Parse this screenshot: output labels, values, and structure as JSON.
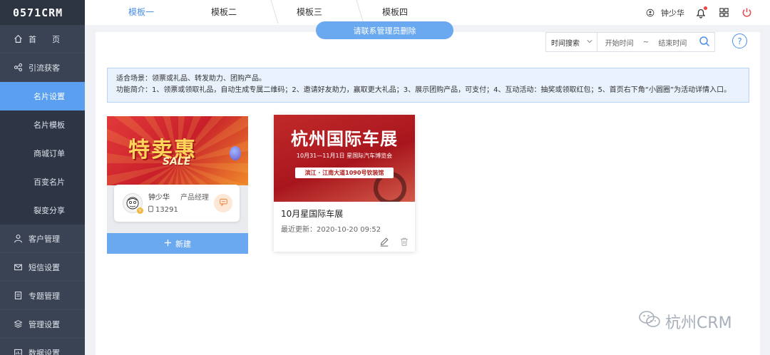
{
  "app": {
    "logo": "0571CRM"
  },
  "sidebar": {
    "items": [
      {
        "label": "首　　页",
        "icon": "home-icon"
      },
      {
        "label": "引流获客",
        "icon": "share-nodes-icon"
      },
      {
        "label": "客户管理",
        "icon": "user-icon"
      },
      {
        "label": "短信设置",
        "icon": "mail-icon"
      },
      {
        "label": "专题管理",
        "icon": "document-icon"
      },
      {
        "label": "管理设置",
        "icon": "layers-icon"
      },
      {
        "label": "数据设置",
        "icon": "chart-icon"
      }
    ],
    "sub_items": [
      {
        "label": "名片设置",
        "active": true
      },
      {
        "label": "名片模板"
      },
      {
        "label": "商城订单"
      },
      {
        "label": "百变名片"
      },
      {
        "label": "裂变分享"
      }
    ]
  },
  "header": {
    "username": "钟少华"
  },
  "tabs": [
    {
      "label": "模板一",
      "active": true
    },
    {
      "label": "模板二"
    },
    {
      "label": "模板三"
    },
    {
      "label": "模板四"
    }
  ],
  "tip_pill": "请联系管理员删除",
  "search": {
    "type_label": "时间搜索",
    "start_placeholder": "开始时间",
    "separator": "~",
    "end_placeholder": "结束时间"
  },
  "help_label": "?",
  "info": {
    "line1": "适合场景：领票或礼品、转发助力、团购产品。",
    "line2": "功能简介：1、领票或领取礼品，自动生成专属二维码；2、邀请好友助力，赢取更大礼品；3、展示团购产品，可支付；4、互动活动：抽奖或领取红包；5、首页右下角“小圆圈”为活动详情入口。"
  },
  "card_template": {
    "banner_title": "特卖惠",
    "banner_sub": "SALE",
    "name": "钟少华",
    "role": "产品经理",
    "phone": "13291",
    "new_label": "新建"
  },
  "card_event": {
    "banner_title": "杭州国际车展",
    "banner_sub": "10月31—11月1日 星国际汽车博览会",
    "banner_addr": "滨江 · 江南大道1090号钦装馆",
    "title": "10月星国际车展",
    "updated": "最近更新：2020-10-20 09:52"
  },
  "watermark": "杭州CRM"
}
